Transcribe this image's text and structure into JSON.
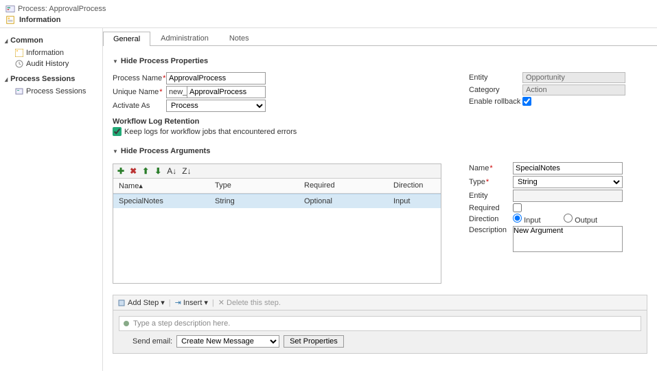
{
  "header": {
    "breadcrumb": "Process: ApprovalProcess",
    "title": "Information"
  },
  "sidebar": {
    "section1": "Common",
    "items1": [
      "Information",
      "Audit History"
    ],
    "section2": "Process Sessions",
    "items2": [
      "Process Sessions"
    ]
  },
  "tabs": [
    "General",
    "Administration",
    "Notes"
  ],
  "section_properties": "Hide Process Properties",
  "form": {
    "process_name_label": "Process Name",
    "process_name": "ApprovalProcess",
    "unique_name_label": "Unique Name",
    "unique_name_prefix": "new_",
    "unique_name": "ApprovalProcess",
    "activate_as_label": "Activate As",
    "activate_as": "Process",
    "entity_label": "Entity",
    "entity": "Opportunity",
    "category_label": "Category",
    "category": "Action",
    "enable_rollback_label": "Enable rollback"
  },
  "wflog": {
    "header": "Workflow Log Retention",
    "keep_logs": "Keep logs for workflow jobs that encountered errors"
  },
  "section_args": "Hide Process Arguments",
  "grid": {
    "cols": [
      "Name▴",
      "Type",
      "Required",
      "Direction"
    ],
    "row": [
      "SpecialNotes",
      "String",
      "Optional",
      "Input"
    ]
  },
  "arg": {
    "name_label": "Name",
    "name": "SpecialNotes",
    "type_label": "Type",
    "type": "String",
    "entity_label": "Entity",
    "required_label": "Required",
    "direction_label": "Direction",
    "dir_input": "Input",
    "dir_output": "Output",
    "description_label": "Description",
    "description": "New Argument"
  },
  "steps": {
    "add_step": "Add Step",
    "insert": "Insert",
    "delete": "Delete this step.",
    "placeholder": "Type a step description here.",
    "send_email": "Send email:",
    "create_msg": "Create New Message",
    "set_props": "Set Properties"
  }
}
